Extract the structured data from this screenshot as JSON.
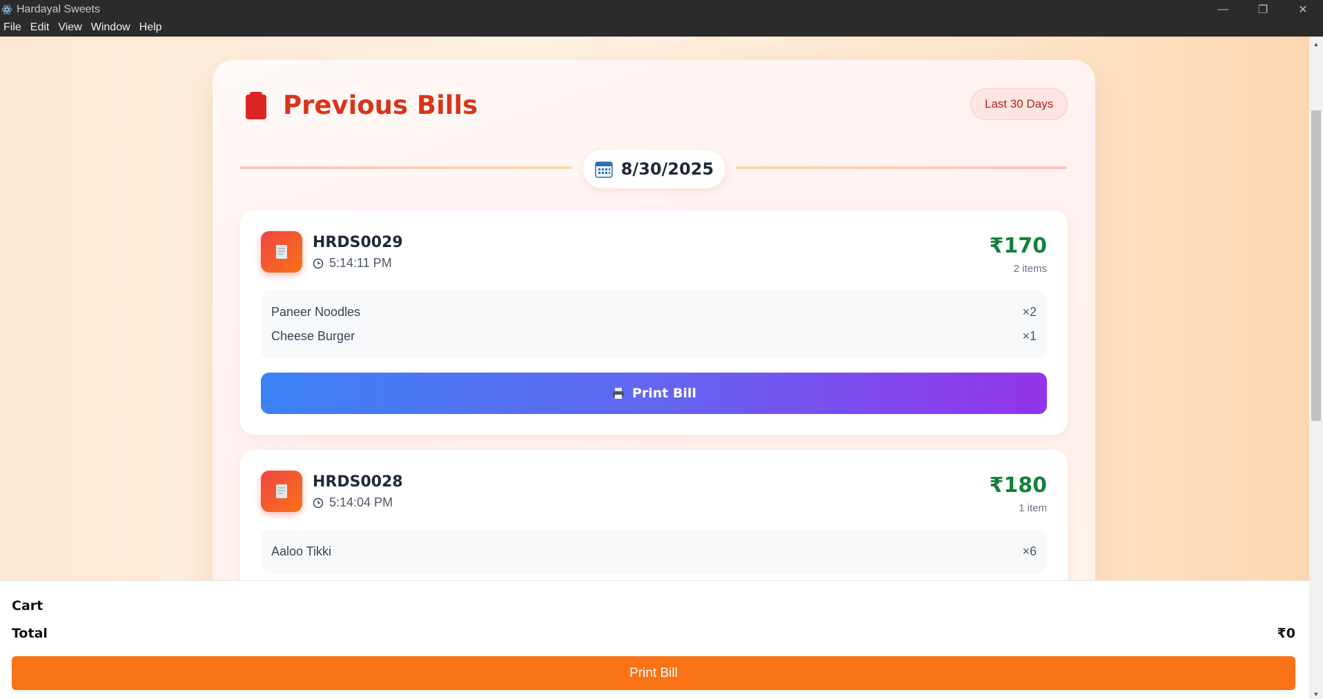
{
  "window": {
    "title": "Hardayal Sweets",
    "minimize": "—",
    "maximize": "❐",
    "close": "✕"
  },
  "menu": {
    "items": [
      "File",
      "Edit",
      "View",
      "Window",
      "Help"
    ]
  },
  "header": {
    "title": "Previous Bills",
    "badge": "Last 30 Days"
  },
  "date": {
    "label": "8/30/2025"
  },
  "bills": [
    {
      "id": "HRDS0029",
      "time": "5:14:11 PM",
      "amount": "₹170",
      "count": "2 items",
      "items": [
        {
          "name": "Paneer Noodles",
          "qty": "×2"
        },
        {
          "name": "Cheese Burger",
          "qty": "×1"
        }
      ],
      "print_label": "Print Bill"
    },
    {
      "id": "HRDS0028",
      "time": "5:14:04 PM",
      "amount": "₹180",
      "count": "1 item",
      "items": [
        {
          "name": "Aaloo Tikki",
          "qty": "×6"
        }
      ]
    }
  ],
  "cart": {
    "title": "Cart",
    "total_label": "Total",
    "total_value": "₹0",
    "print_label": "Print Bill"
  },
  "colors": {
    "accent": "#d9341a",
    "amount": "#15803d",
    "cart_button": "#f97316"
  }
}
